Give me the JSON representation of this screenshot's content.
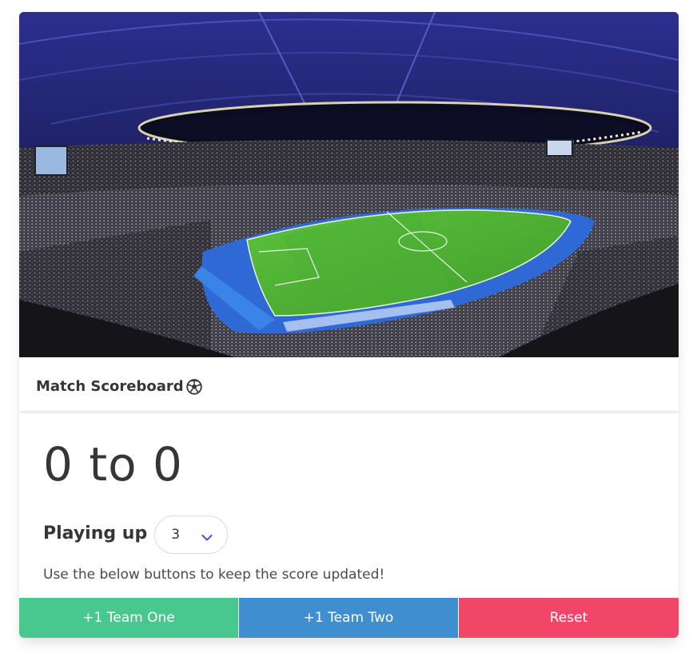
{
  "card": {
    "header_title": "Match Scoreboard",
    "header_icon": "soccer-ball-icon"
  },
  "score": {
    "text": "0 to 0",
    "team_one": 0,
    "team_two": 0
  },
  "playing_up": {
    "label": "Playing up",
    "selected": "3"
  },
  "help_text": "Use the below buttons to keep the score updated!",
  "buttons": {
    "team_one": "+1 Team One",
    "team_two": "+1 Team Two",
    "reset": "Reset"
  },
  "colors": {
    "team_one": "#48c78e",
    "team_two": "#3e8ed0",
    "reset": "#f14668",
    "chevron": "#485fc7",
    "text": "#363636"
  }
}
